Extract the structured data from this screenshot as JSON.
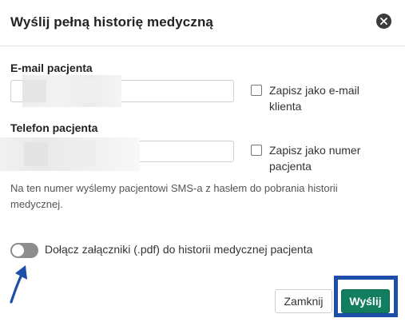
{
  "dialog": {
    "title": "Wyślij pełną historię medyczną"
  },
  "email": {
    "label": "E-mail pacjenta",
    "value": "",
    "checkbox_label": "Zapisz jako e-mail klienta"
  },
  "phone": {
    "label": "Telefon pacjenta",
    "value": "",
    "checkbox_label": "Zapisz jako numer pacjenta",
    "help_text": "Na ten numer wyślemy pacjentowi SMS-a z hasłem do pobrania historii medycznej."
  },
  "attachments": {
    "toggle_label": "Dołącz załączniki (.pdf) do historii medycznej pacjenta",
    "enabled": false
  },
  "buttons": {
    "cancel": "Zamknij",
    "send": "Wyślij"
  },
  "colors": {
    "primary": "#137d5f",
    "highlight": "#1e4fa8",
    "toggle_off": "#8d8d8d"
  },
  "icons": {
    "close": "close-circle-icon",
    "arrow": "arrow-pointer-icon"
  }
}
